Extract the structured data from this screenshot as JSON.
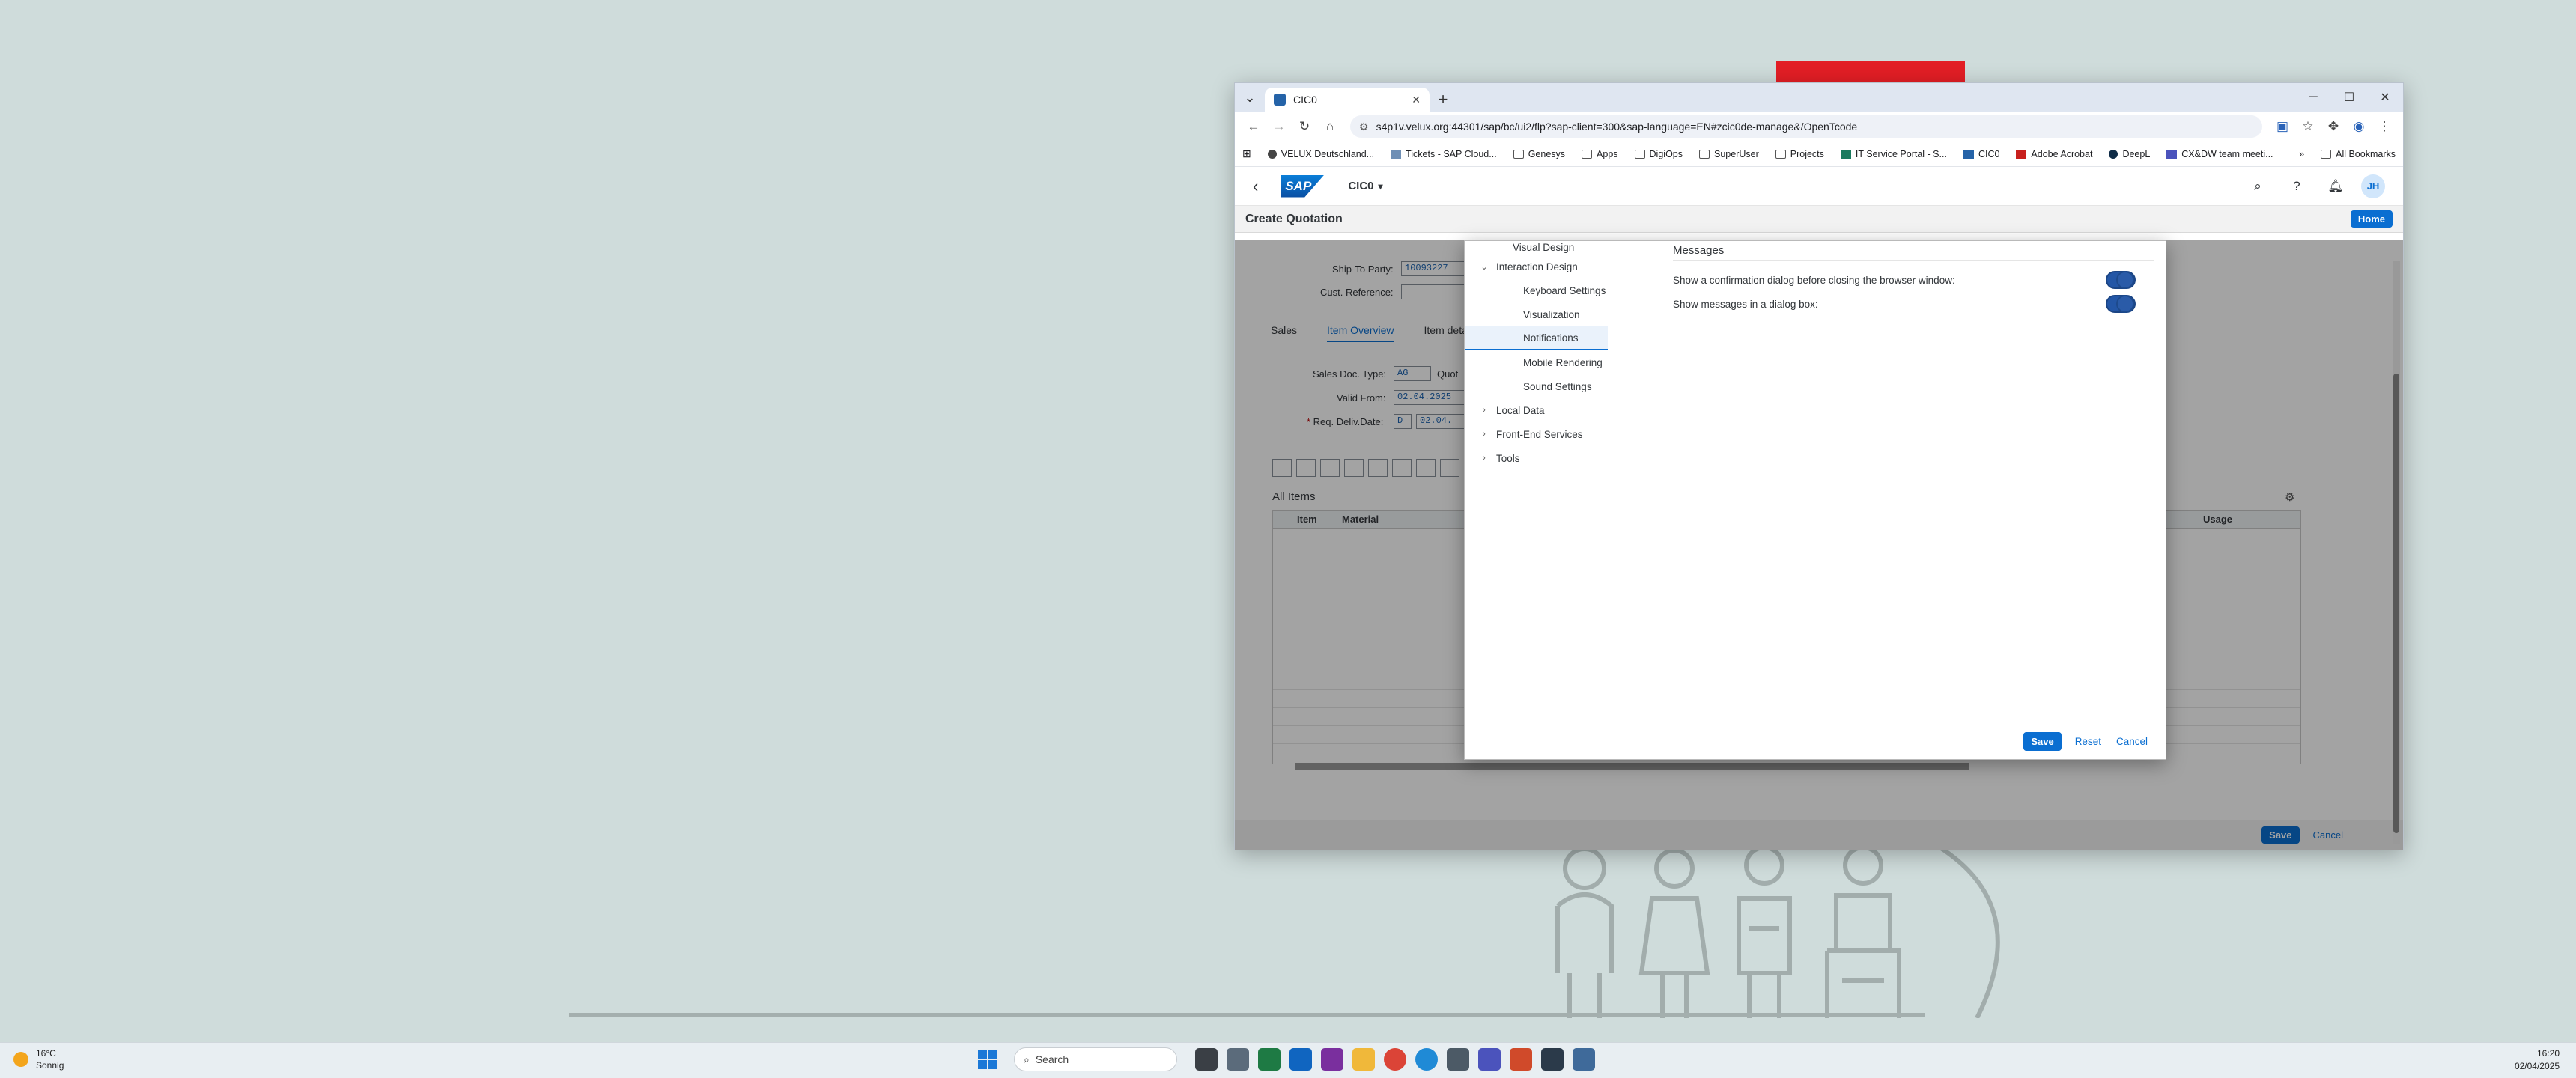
{
  "browser": {
    "tab_title": "CIC0",
    "url": "s4p1v.velux.org:44301/sap/bc/ui2/flp?sap-client=300&sap-language=EN#zcic0de-manage&/OpenTcode",
    "bookmarks": [
      "VELUX Deutschland...",
      "Tickets - SAP Cloud...",
      "Genesys",
      "Apps",
      "DigiOps",
      "SuperUser",
      "Projects",
      "IT Service Portal - S...",
      "CIC0",
      "Adobe Acrobat",
      "DeepL",
      "CX&DW team meeti..."
    ],
    "all_bookmarks": "All Bookmarks"
  },
  "shell": {
    "app_title": "CIC0",
    "avatar": "JH",
    "subheader_title": "Create Quotation",
    "home": "Home"
  },
  "app": {
    "ship_to_label": "Ship-To Party:",
    "ship_to_value": "10093227",
    "cust_ref_label": "Cust. Reference:",
    "tabs": [
      "Sales",
      "Item Overview",
      "Item detail"
    ],
    "doc_type_label": "Sales Doc. Type:",
    "doc_type_value": "AG",
    "quot_label": "Quot",
    "valid_from_label": "Valid From:",
    "valid_from_value": "02.04.2025",
    "req_deliv_label": "Req. Deliv.Date:",
    "req_deliv_prefix": "D",
    "req_deliv_value": "02.04.",
    "all_items": "All Items",
    "columns": [
      "Item",
      "Material",
      "Usage"
    ],
    "footer_save": "Save",
    "footer_cancel": "Cancel"
  },
  "dialog": {
    "tree": [
      {
        "label": "Visual Design",
        "level": 0
      },
      {
        "label": "Interaction Design",
        "level": 1,
        "expanded": true
      },
      {
        "label": "Keyboard Settings",
        "level": 2
      },
      {
        "label": "Visualization",
        "level": 2
      },
      {
        "label": "Notifications",
        "level": 2,
        "selected": true
      },
      {
        "label": "Mobile Rendering",
        "level": 2
      },
      {
        "label": "Sound Settings",
        "level": 2
      },
      {
        "label": "Local Data",
        "level": 1
      },
      {
        "label": "Front-End Services",
        "level": 1
      },
      {
        "label": "Tools",
        "level": 1
      }
    ],
    "section_title": "Messages",
    "settings": [
      {
        "label": "Show a confirmation dialog before closing the browser window:",
        "on": true
      },
      {
        "label": "Show messages in a dialog box:",
        "on": true
      }
    ],
    "save": "Save",
    "reset": "Reset",
    "cancel": "Cancel"
  },
  "taskbar": {
    "temp": "16°C",
    "weather": "Sonnig",
    "search_placeholder": "Search",
    "time": "16:20",
    "date": "02/04/2025"
  },
  "colors": {
    "sap_blue": "#0a6ed1",
    "toggle_on": "#2356a6"
  }
}
